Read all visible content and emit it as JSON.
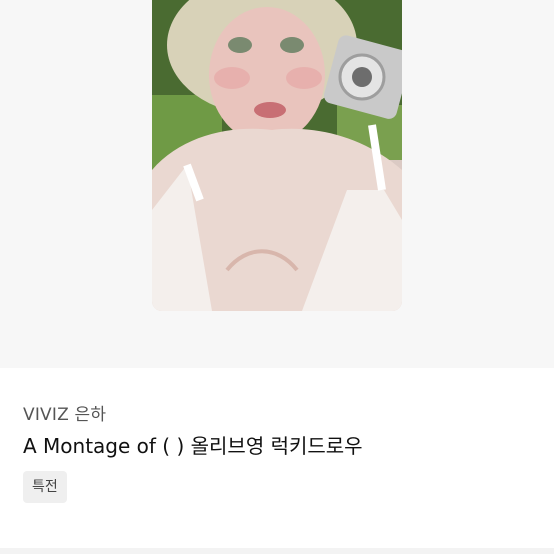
{
  "product": {
    "artist": "VIVIZ 은하",
    "title": "A Montage of ( ) 올리브영 럭키드로우",
    "tag": "특전"
  }
}
